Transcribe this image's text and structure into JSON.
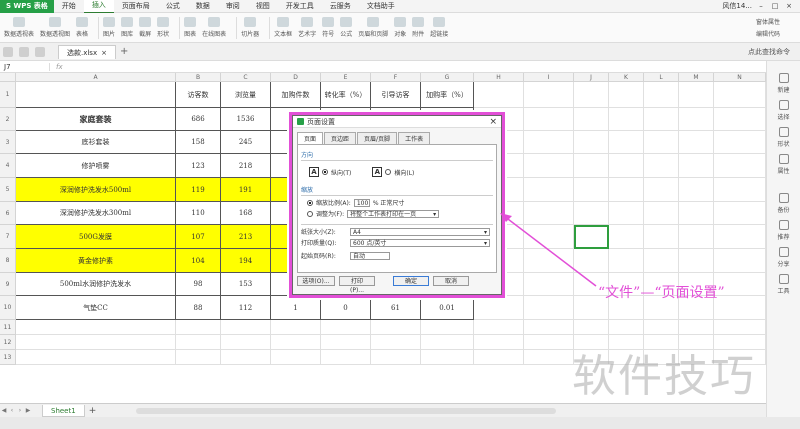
{
  "app": {
    "logo_label": "S WPS 表格",
    "user_name": "风信14..."
  },
  "menu_tabs": [
    "开始",
    "页面布局",
    "公式",
    "数据",
    "审阅",
    "视图",
    "开发工具",
    "云服务",
    "文档助手"
  ],
  "menu_insert_tab": "插入",
  "ribbon": {
    "items": [
      "数据透视表",
      "数据透视图",
      "表格",
      "图片",
      "图库",
      "截屏",
      "形状",
      "图表",
      "在线图表",
      "切片器",
      "文本框",
      "艺术字",
      "符号",
      "公式",
      "页眉和页脚",
      "对象",
      "附件",
      "超链接"
    ],
    "right": [
      "窗体属性",
      "编辑代码"
    ]
  },
  "doc_tab": {
    "name": "选款.xlsx"
  },
  "search_label": "点此查找命令",
  "cell_ref": "J7",
  "fx_label": "fx",
  "columns": [
    "A",
    "B",
    "C",
    "D",
    "E",
    "F",
    "G",
    "H",
    "I",
    "J",
    "K",
    "L",
    "M",
    "N"
  ],
  "headers": [
    "",
    "访客数",
    "浏览量",
    "加购件数",
    "转化率（%）",
    "引导访客",
    "加购率（%）"
  ],
  "rows": [
    {
      "num": "1",
      "cells": [
        "",
        "访客数",
        "浏览量",
        "加购件数",
        "转化率（%）",
        "引导访客",
        "加购率（%）"
      ]
    },
    {
      "num": "2",
      "cells": [
        "家庭套装",
        "686",
        "1536",
        "",
        "",
        "",
        ""
      ]
    },
    {
      "num": "3",
      "cells": [
        "底衫套装",
        "158",
        "245",
        "",
        "",
        "",
        ""
      ]
    },
    {
      "num": "4",
      "cells": [
        "修护喷雾",
        "123",
        "218",
        "",
        "",
        "",
        ""
      ]
    },
    {
      "num": "5",
      "cells": [
        "深润修护洗发水500ml",
        "119",
        "191",
        "",
        "",
        "",
        ""
      ]
    },
    {
      "num": "6",
      "cells": [
        "深润修护洗发水300ml",
        "110",
        "168",
        "",
        "",
        "",
        ""
      ]
    },
    {
      "num": "7",
      "cells": [
        "500G发膜",
        "107",
        "213",
        "",
        "",
        "",
        ""
      ]
    },
    {
      "num": "8",
      "cells": [
        "黄金修护素",
        "104",
        "194",
        "",
        "",
        "",
        ""
      ]
    },
    {
      "num": "9",
      "cells": [
        "500ml水润修护洗发水",
        "98",
        "153",
        "",
        "",
        "",
        ""
      ]
    },
    {
      "num": "10",
      "cells": [
        "气垫CC",
        "88",
        "112",
        "1",
        "0",
        "61",
        "0.01"
      ]
    },
    {
      "num": "11",
      "cells": [
        "",
        "",
        "",
        "",
        "",
        "",
        ""
      ]
    },
    {
      "num": "12",
      "cells": [
        "",
        "",
        "",
        "",
        "",
        "",
        ""
      ]
    },
    {
      "num": "13",
      "cells": [
        "",
        "",
        "",
        "",
        "",
        "",
        ""
      ]
    }
  ],
  "highlight_rows": [
    "5",
    "7",
    "8"
  ],
  "highlight_color": "#ffff00",
  "sidebar": [
    "新建",
    "选择",
    "形状",
    "属性",
    "备份",
    "推荐",
    "分享",
    "工具"
  ],
  "sheet_tab": "Sheet1",
  "dialog": {
    "title": "页面设置",
    "tabs": [
      "页面",
      "页边距",
      "页眉/页脚",
      "工作表"
    ],
    "orientation_label": "方向",
    "portrait": "纵向(T)",
    "landscape": "横向(L)",
    "scaling_label": "缩放",
    "scale_ratio_label": "缩放比例(A):",
    "scale_value": "100",
    "scale_suffix": "% 正常尺寸",
    "fit_label": "调整为(F):",
    "fit_value": "将整个工作表打印在一页",
    "paper_size_label": "纸张大小(Z):",
    "paper_size_value": "A4",
    "print_quality_label": "打印质量(Q):",
    "print_quality_value": "600 点/英寸",
    "first_page_label": "起始页码(R):",
    "first_page_value": "自动",
    "btn_options": "选项(O)...",
    "btn_print": "打印(P)...",
    "btn_ok": "确定",
    "btn_cancel": "取消"
  },
  "annotation": "“文件”—“页面设置”",
  "annotation_color": "#e24fd7",
  "watermark": "软件技巧"
}
